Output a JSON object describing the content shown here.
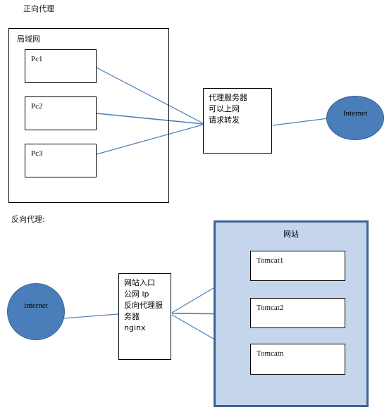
{
  "diagram": {
    "title_forward": "正向代理",
    "title_reverse": "反向代理:",
    "colors": {
      "node_blue": "#4a7ebb",
      "panel_fill": "#c5d5ec",
      "panel_border": "#3b6595",
      "connector": "#4a7ebb",
      "box_border": "#000000"
    }
  },
  "forward_proxy": {
    "lan": {
      "label": "局域网",
      "clients": [
        {
          "label": "Pc1"
        },
        {
          "label": "Pc2"
        },
        {
          "label": "Pc3"
        }
      ]
    },
    "proxy_server": {
      "lines": [
        "代理服务器",
        "可以上网",
        "请求转发"
      ],
      "text": "代理服务器\n可以上网\n请求转发"
    },
    "internet": {
      "label": "Internet"
    }
  },
  "reverse_proxy": {
    "internet": {
      "label": "internet"
    },
    "entry": {
      "lines": [
        "网站入口",
        "公网 ip",
        "反向代理服",
        "务器",
        "nginx"
      ],
      "text": "网站入口\n公网 ip\n反向代理服\n务器\nnginx"
    },
    "website": {
      "title": "网站",
      "servers": [
        {
          "label": "Tomcat1"
        },
        {
          "label": "Tomcat2"
        },
        {
          "label": "Tomcatn"
        }
      ]
    }
  }
}
